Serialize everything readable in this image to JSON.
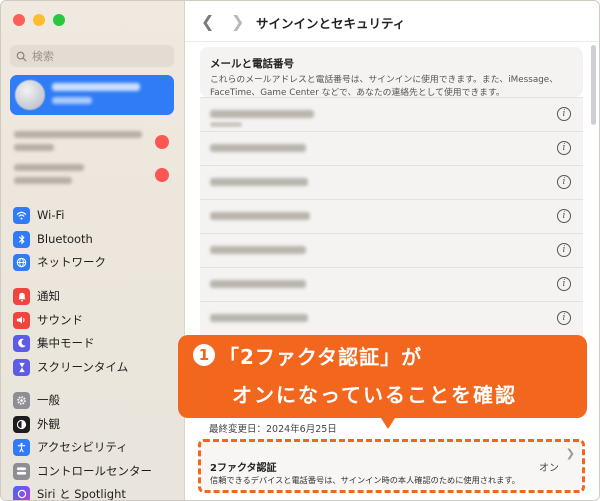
{
  "search": {
    "placeholder": "検索"
  },
  "sidebar": {
    "items": [
      {
        "label": "Wi-Fi",
        "icon": "wifi-icon",
        "color": "#2f7cf6"
      },
      {
        "label": "Bluetooth",
        "icon": "bluetooth-icon",
        "color": "#2f7cf6"
      },
      {
        "label": "ネットワーク",
        "icon": "globe-icon",
        "color": "#2f7cf6"
      },
      {
        "label": "通知",
        "icon": "bell-icon",
        "color": "#f0453f"
      },
      {
        "label": "サウンド",
        "icon": "speaker-icon",
        "color": "#f0453f"
      },
      {
        "label": "集中モード",
        "icon": "moon-icon",
        "color": "#5e5ce6"
      },
      {
        "label": "スクリーンタイム",
        "icon": "hourglass-icon",
        "color": "#5e5ce6"
      },
      {
        "label": "一般",
        "icon": "gear-icon",
        "color": "#8e8e93"
      },
      {
        "label": "外観",
        "icon": "appearance-icon",
        "color": "#1c1c1e"
      },
      {
        "label": "アクセシビリティ",
        "icon": "accessibility-icon",
        "color": "#2f7cf6"
      },
      {
        "label": "コントロールセンター",
        "icon": "control-center-icon",
        "color": "#8e8e93"
      },
      {
        "label": "Siri と Spotlight",
        "icon": "siri-icon",
        "color": "#7d3cf0"
      }
    ]
  },
  "header": {
    "title": "サインインとセキュリティ"
  },
  "email_phone": {
    "title": "メールと電話番号",
    "description": "これらのメールアドレスと電話番号は、サインインに使用できます。また、iMessage、FaceTime、Game Center などで、あなたの連絡先として使用できます。"
  },
  "last_modified": "最終変更日：2024年6月25日",
  "two_factor": {
    "title": "2ファクタ認証",
    "description": "信頼できるデバイスと電話番号は、サインイン時の本人確認のために使用されます。",
    "status": "オン"
  },
  "callout": {
    "step": "1",
    "line1": "「2ファクタ認証」が",
    "line2": "オンになっていることを確認"
  },
  "colors": {
    "accent": "#f2661e",
    "selection": "#2f7cf6"
  }
}
